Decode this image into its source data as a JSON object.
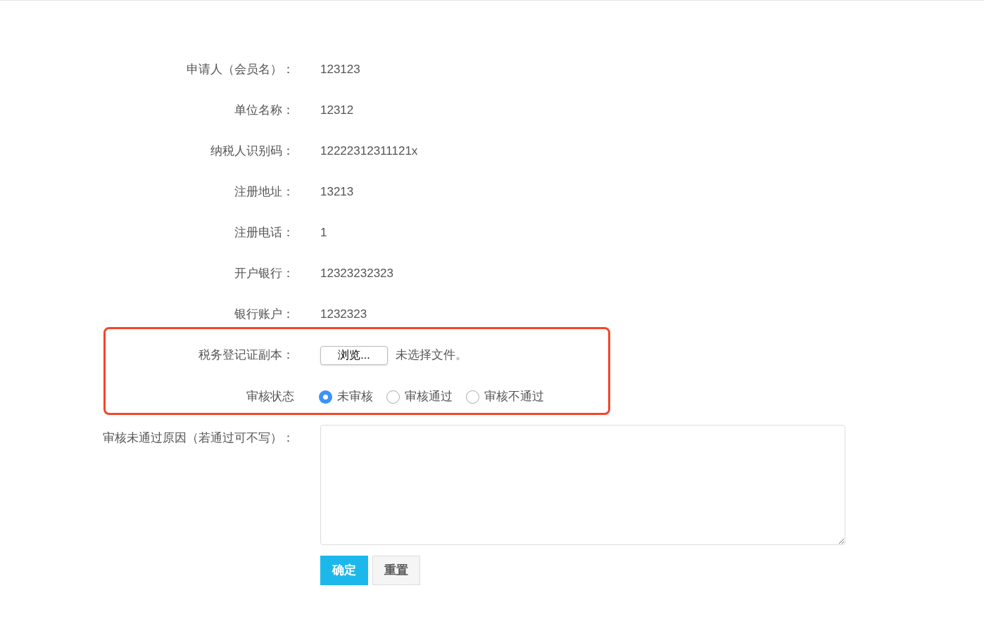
{
  "sections": [
    {
      "highlighted": false,
      "rows": [
        {
          "kind": "text",
          "label": "申请人（会员名）：",
          "value": "123123"
        },
        {
          "kind": "text",
          "label": "单位名称：",
          "value": "12312"
        },
        {
          "kind": "text",
          "label": "纳税人识别码：",
          "value": "12222312311121x"
        },
        {
          "kind": "text",
          "label": "注册地址：",
          "value": "13213"
        },
        {
          "kind": "text",
          "label": "注册电话：",
          "value": "1"
        },
        {
          "kind": "text",
          "label": "开户银行：",
          "value": "12323232323"
        },
        {
          "kind": "text",
          "label": "银行账户：",
          "value": "1232323"
        }
      ]
    },
    {
      "highlighted": true,
      "rows": [
        {
          "kind": "file",
          "label": "税务登记证副本：",
          "button": "浏览...",
          "value": "未选择文件。"
        },
        {
          "kind": "radio",
          "label": "审核状态",
          "options": [
            {
              "label": "未审核",
              "selected": true
            },
            {
              "label": "审核通过",
              "selected": false
            },
            {
              "label": "审核不通过",
              "selected": false
            }
          ]
        }
      ]
    },
    {
      "highlighted": false,
      "rows": [
        {
          "kind": "textarea",
          "label": "审核未通过原因（若通过可不写）："
        }
      ]
    }
  ],
  "buttons": [
    {
      "kind": "primary",
      "label": "确定"
    },
    {
      "kind": "secondary",
      "label": "重置"
    }
  ]
}
